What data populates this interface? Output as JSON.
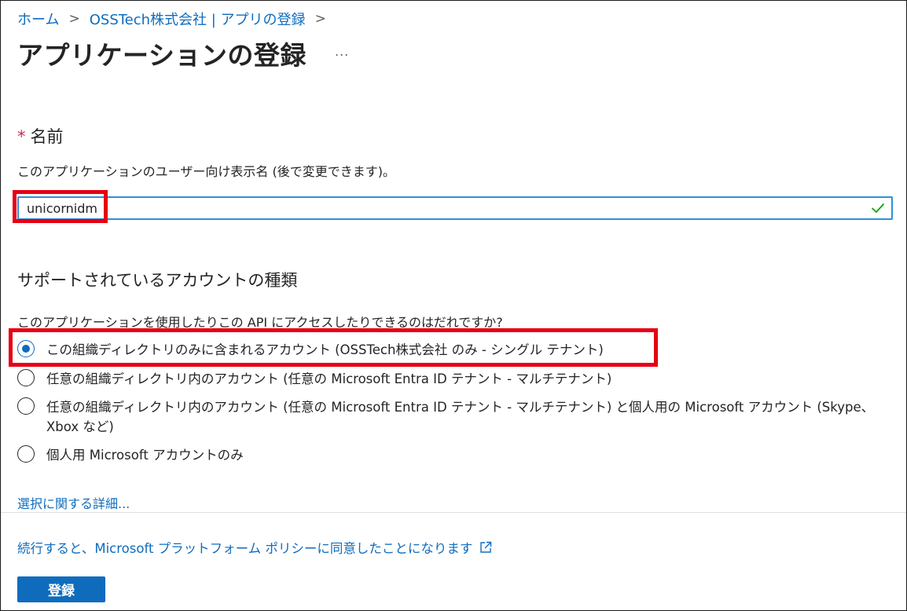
{
  "breadcrumb": {
    "items": [
      "ホーム",
      "OSSTech株式会社 | アプリの登録"
    ],
    "separator": ">"
  },
  "page": {
    "title": "アプリケーションの登録",
    "more_label": "..."
  },
  "name_field": {
    "required_mark": "*",
    "label": "名前",
    "description": "このアプリケーションのユーザー向け表示名 (後で変更できます)。",
    "value": "unicornidm"
  },
  "account_types": {
    "heading": "サポートされているアカウントの種類",
    "question": "このアプリケーションを使用したりこの API にアクセスしたりできるのはだれですか?",
    "options": [
      {
        "label": "この組織ディレクトリのみに含まれるアカウント (OSSTech株式会社 のみ - シングル テナント)",
        "selected": true
      },
      {
        "label": "任意の組織ディレクトリ内のアカウント (任意の Microsoft Entra ID テナント - マルチテナント)",
        "selected": false
      },
      {
        "label": "任意の組織ディレクトリ内のアカウント (任意の Microsoft Entra ID テナント - マルチテナント) と個人用の Microsoft アカウント (Skype、Xbox など)",
        "selected": false
      },
      {
        "label": "個人用 Microsoft アカウントのみ",
        "selected": false
      }
    ],
    "learn_more": "選択に関する詳細..."
  },
  "footer": {
    "policy_text": "続行すると、Microsoft プラットフォーム ポリシーに同意したことになります",
    "register_button": "登録"
  },
  "colors": {
    "link": "#0f6cbd",
    "primary_button": "#0f6cbd",
    "highlight_box": "#e60012",
    "valid_check": "#13a10e",
    "required_asterisk": "#c4314b"
  }
}
